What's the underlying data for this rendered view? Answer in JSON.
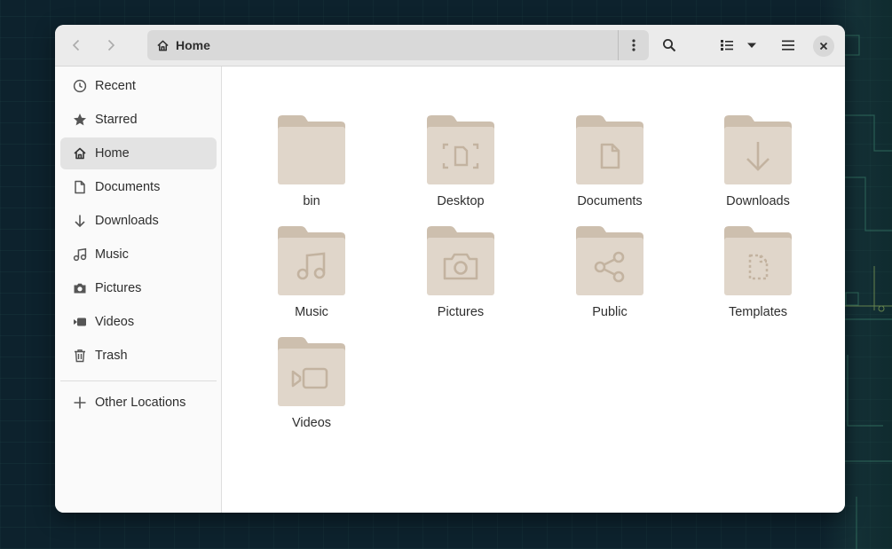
{
  "window": {
    "location": "Home",
    "accent_folder_color": "#e0d6ca",
    "folder_tab_color": "#cdbfae",
    "folder_glyph_color": "#c3b3a0"
  },
  "headerbar": {
    "back_icon": "chevron-left-icon",
    "forward_icon": "chevron-right-icon",
    "path_menu_icon": "vertical-dots-icon",
    "search_icon": "search-icon",
    "view_icon": "list-view-icon",
    "view_dropdown_icon": "caret-down-icon",
    "main_menu_icon": "hamburger-icon",
    "close_icon": "close-icon"
  },
  "sidebar": {
    "items": [
      {
        "label": "Recent",
        "icon": "clock-icon"
      },
      {
        "label": "Starred",
        "icon": "star-icon"
      },
      {
        "label": "Home",
        "icon": "home-icon"
      },
      {
        "label": "Documents",
        "icon": "document-icon"
      },
      {
        "label": "Downloads",
        "icon": "download-icon"
      },
      {
        "label": "Music",
        "icon": "music-icon"
      },
      {
        "label": "Pictures",
        "icon": "camera-icon"
      },
      {
        "label": "Videos",
        "icon": "video-icon"
      },
      {
        "label": "Trash",
        "icon": "trash-icon"
      }
    ],
    "other_locations": {
      "label": "Other Locations",
      "icon": "plus-icon"
    }
  },
  "folders": [
    {
      "label": "bin",
      "glyph": "none"
    },
    {
      "label": "Desktop",
      "glyph": "desktop-icon"
    },
    {
      "label": "Documents",
      "glyph": "document-icon"
    },
    {
      "label": "Downloads",
      "glyph": "download-icon"
    },
    {
      "label": "Music",
      "glyph": "music-icon"
    },
    {
      "label": "Pictures",
      "glyph": "camera-icon"
    },
    {
      "label": "Public",
      "glyph": "share-icon"
    },
    {
      "label": "Templates",
      "glyph": "template-icon"
    },
    {
      "label": "Videos",
      "glyph": "video-icon"
    }
  ]
}
